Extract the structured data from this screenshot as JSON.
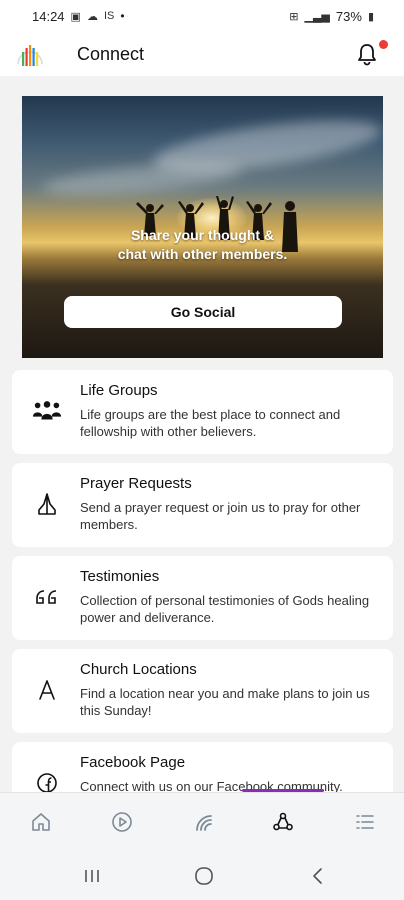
{
  "status_bar": {
    "time": "14:24",
    "carrier": "IS",
    "dot": "•",
    "battery": "73%"
  },
  "header": {
    "title": "Connect",
    "logo_icon": "church-logo-icon",
    "notification_icon": "bell-icon",
    "notification_dot_color": "#ef3b35"
  },
  "hero": {
    "line1": "Share your thought &",
    "line2": "chat with other members.",
    "button_label": "Go Social"
  },
  "cards": [
    {
      "icon": "people-group-icon",
      "title": "Life Groups",
      "description": "Life groups are the best place to connect and fellowship with other believers."
    },
    {
      "icon": "praying-hands-icon",
      "title": "Prayer Requests",
      "description": "Send a prayer request or join us to pray for other members."
    },
    {
      "icon": "quote-icon",
      "title": "Testimonies",
      "description": "Collection of personal testimonies of Gods healing power and deliverance."
    },
    {
      "icon": "location-icon",
      "title": "Church Locations",
      "description": "Find a location near you and make plans to join us this Sunday!"
    },
    {
      "icon": "facebook-icon",
      "title": "Facebook Page",
      "description": "Connect with us on our Facebook community."
    }
  ],
  "bottom_nav": {
    "items": [
      "home-icon",
      "play-icon",
      "broadcast-icon",
      "connect-icon",
      "menu-list-icon"
    ],
    "active": "connect-icon",
    "indicator_color": "#8a2bb9"
  },
  "system_nav": [
    "recents-icon",
    "home-circle-icon",
    "back-icon"
  ]
}
